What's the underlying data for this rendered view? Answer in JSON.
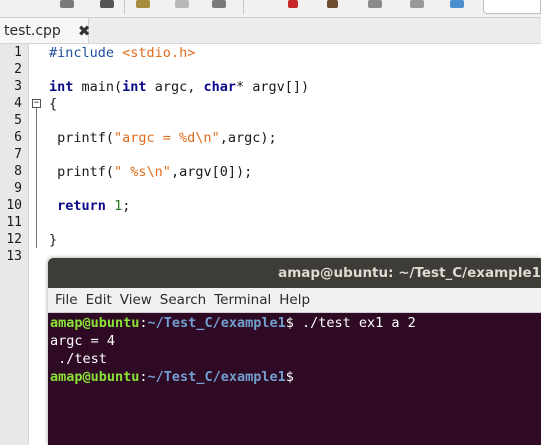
{
  "editor": {
    "tab": {
      "label": "test.cpp",
      "close_glyph": "✖"
    },
    "line_numbers": [
      "1",
      "2",
      "3",
      "4",
      "5",
      "6",
      "7",
      "8",
      "9",
      "10",
      "11",
      "12",
      "13"
    ],
    "lines": {
      "l1": {
        "directive": "#include",
        "header": "<stdio.h>"
      },
      "l3": {
        "kw_int": "int",
        "main": " main(",
        "kw_int2": "int",
        "argc": " argc, ",
        "kw_char": "char",
        "argv": "* argv[])"
      },
      "l4": "{",
      "l6": {
        "call": " printf(",
        "fmt": "\"argc = %d\\n\"",
        "rest": ",argc);"
      },
      "l8": {
        "call": " printf(",
        "fmt": "\" %s\\n\"",
        "rest": ",argv[0]);"
      },
      "l10": {
        "kw_return": "return",
        "space": " ",
        "value": "1",
        "semi": ";"
      },
      "l12": "}"
    },
    "fold_glyph": "−"
  },
  "terminal": {
    "title": "amap@ubuntu: ~/Test_C/example1",
    "menu": [
      "File",
      "Edit",
      "View",
      "Search",
      "Terminal",
      "Help"
    ],
    "lines": {
      "p1_user": "amap@ubuntu",
      "p1_colon": ":",
      "p1_path": "~/Test_C/example1",
      "p1_cmd": "$ ./test ex1 a 2",
      "out1": "argc = 4",
      "out2": " ./test",
      "p2_user": "amap@ubuntu",
      "p2_colon": ":",
      "p2_path": "~/Test_C/example1",
      "p2_cmd": "$"
    }
  },
  "colors": {
    "terminal_bg": "#2f0a24",
    "prompt_user": "#8ae234",
    "prompt_path": "#729fcf",
    "string_literal": "#e06c1c",
    "keyword": "#0a0a8a"
  }
}
